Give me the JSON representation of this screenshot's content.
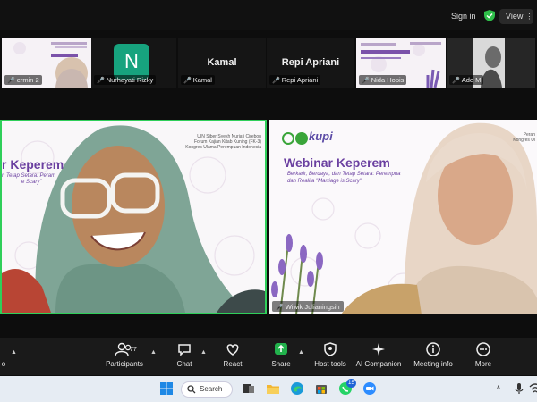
{
  "topbar": {
    "signin_label": "Sign in",
    "view_label": "View",
    "view_dots": "⋮"
  },
  "thumbnails": [
    {
      "name": "ermin 2",
      "kind": "slide"
    },
    {
      "name": "Nurhayati Rizky",
      "kind": "avatar",
      "avatar_letter": "N",
      "avatar_color": "#17a37e"
    },
    {
      "name": "Kamal",
      "kind": "name"
    },
    {
      "name": "Repi Apriani",
      "kind": "name"
    },
    {
      "name": "Nida Hopis",
      "kind": "slide"
    },
    {
      "name": "Ade M",
      "kind": "video"
    }
  ],
  "main_left": {
    "slide_org": [
      "UIN Siber Syekh Nurjati Cirebon",
      "Forum Kajian Kitab Kuning (FK-3)",
      "Kongres Ulama Perempuan Indonesia"
    ],
    "title_fragment": "r Keperem",
    "subtitle_fragment_1": "n Tetap Setara: Peram",
    "subtitle_fragment_2": "e Scary\""
  },
  "main_right": {
    "participant_name": "Wiwik Julianingsih",
    "logo_text": "kupi",
    "slide_org": [
      "Peran",
      "Kongres Ul"
    ],
    "title": "Webinar Keperem",
    "subtitle_1": "Berkarir, Berdaya, dan Tetap Setara: Perempua",
    "subtitle_2": "dan Realita \"Marriage is Scary\""
  },
  "controls": {
    "left_label": "o",
    "participants_label": "Participants",
    "participants_count": "77",
    "chat_label": "Chat",
    "react_label": "React",
    "share_label": "Share",
    "host_tools_label": "Host tools",
    "ai_companion_label": "AI Companion",
    "meeting_info_label": "Meeting info",
    "more_label": "More"
  },
  "taskbar": {
    "search_label": "Search",
    "badge_count": "15"
  },
  "colors": {
    "active_speaker": "#2fcf5a",
    "share_green": "#22b24c",
    "kupi_green": "#3aa53a",
    "webinar_purple": "#6a3fa0"
  }
}
